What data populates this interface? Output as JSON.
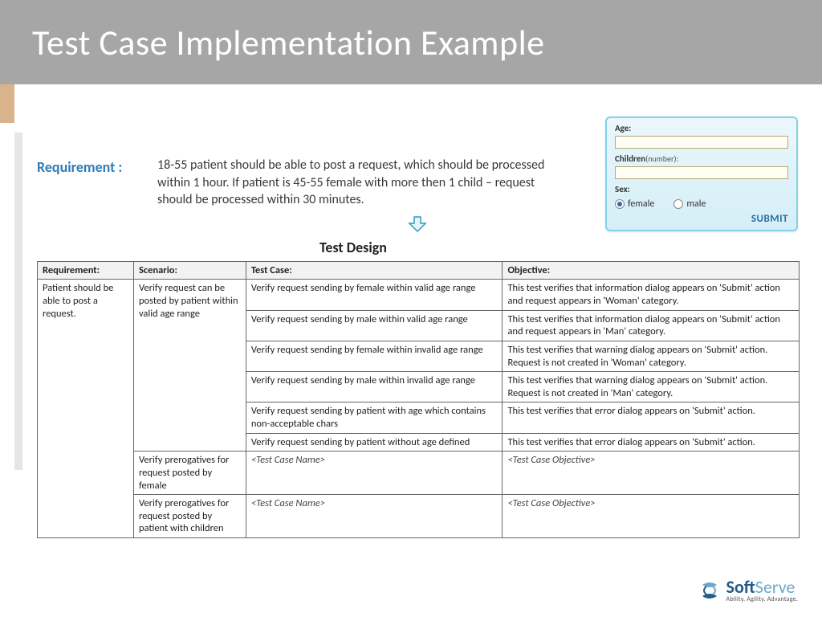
{
  "title": "Test Case Implementation Example",
  "requirement": {
    "label": "Requirement :",
    "text": "18-55 patient should be able to post a request, which should be processed within 1 hour. If patient is 45-55 female with more then 1 child – request should be processed within 30 minutes."
  },
  "test_design_heading": "Test Design",
  "form": {
    "age_label": "Age:",
    "age_value": "",
    "children_label": "Children",
    "children_sublabel": "(number):",
    "children_value": "",
    "sex_label": "Sex:",
    "female_label": "female",
    "male_label": "male",
    "submit_label": "SUBMIT"
  },
  "table": {
    "headers": {
      "requirement": "Requirement:",
      "scenario": "Scenario:",
      "test_case": "Test Case:",
      "objective": "Objective:"
    },
    "req_cell": "Patient should be able to post a request.",
    "scenario1": "Verify request can be posted by patient within valid age range",
    "scenario2": "Verify prerogatives for request posted by female",
    "scenario3": "Verify prerogatives for request posted by patient with children",
    "rows": [
      {
        "tc": "Verify request sending by female within valid age range",
        "obj": "This test verifies that information dialog appears on 'Submit' action and request appears in 'Woman' category."
      },
      {
        "tc": "Verify request sending by male within valid age range",
        "obj": "This test verifies that information dialog appears on 'Submit' action and request appears in 'Man' category."
      },
      {
        "tc": "Verify request sending by female within invalid age range",
        "obj": "This test verifies that warning dialog appears on 'Submit' action. Request is not created in 'Woman' category."
      },
      {
        "tc": "Verify request sending by male within invalid age range",
        "obj": "This test verifies that warning dialog appears on 'Submit' action. Request is not created in 'Man' category."
      },
      {
        "tc": "Verify request sending by patient with age which contains non-acceptable chars",
        "obj": "This test verifies that error dialog appears on 'Submit' action."
      },
      {
        "tc": "Verify request sending by patient without age defined",
        "obj": "This test verifies that error dialog appears on 'Submit' action."
      }
    ],
    "placeholder_tc": "<Test Case Name>",
    "placeholder_obj": "<Test Case Objective>"
  },
  "logo": {
    "name_a": "Soft",
    "name_b": "Serve",
    "tagline": "Ability. Agility. Advantage."
  }
}
